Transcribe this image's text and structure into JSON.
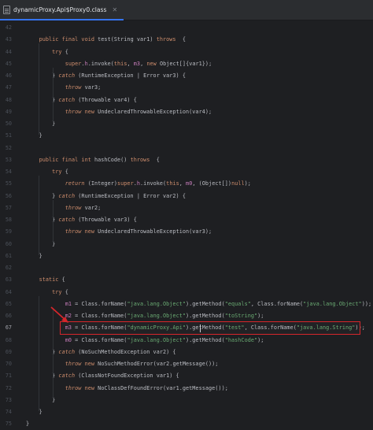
{
  "tab": {
    "label": "dynamicProxy.Api$Proxy0.class",
    "icon": "class-file-icon"
  },
  "editor": {
    "current_line": "67",
    "lines": [
      {
        "n": "42",
        "segs": []
      },
      {
        "n": "43",
        "segs": [
          [
            "    ",
            ""
          ],
          [
            "public final void",
            "kw"
          ],
          [
            " test(String var1) ",
            ""
          ],
          [
            "throws",
            "kw"
          ],
          [
            "  {",
            ""
          ]
        ]
      },
      {
        "n": "44",
        "segs": [
          [
            "        ",
            ""
          ],
          [
            "try",
            "kw"
          ],
          [
            " {",
            ""
          ]
        ]
      },
      {
        "n": "45",
        "segs": [
          [
            "            ",
            ""
          ],
          [
            "super",
            "kw"
          ],
          [
            ".",
            ""
          ],
          [
            "h",
            "fld"
          ],
          [
            ".invoke(",
            ""
          ],
          [
            "this",
            "kw"
          ],
          [
            ", ",
            ""
          ],
          [
            "m3",
            "fld"
          ],
          [
            ", ",
            ""
          ],
          [
            "new",
            "kw"
          ],
          [
            " Object[]{var1});",
            ""
          ]
        ]
      },
      {
        "n": "46",
        "segs": [
          [
            "        } ",
            ""
          ],
          [
            "catch",
            "kwi"
          ],
          [
            " (RuntimeException | Error var3) {",
            ""
          ]
        ]
      },
      {
        "n": "47",
        "segs": [
          [
            "            ",
            ""
          ],
          [
            "throw",
            "kwi"
          ],
          [
            " var3;",
            ""
          ]
        ]
      },
      {
        "n": "48",
        "segs": [
          [
            "        } ",
            ""
          ],
          [
            "catch",
            "kwi"
          ],
          [
            " (Throwable var4) {",
            ""
          ]
        ]
      },
      {
        "n": "49",
        "segs": [
          [
            "            ",
            ""
          ],
          [
            "throw",
            "kwi"
          ],
          [
            " ",
            ""
          ],
          [
            "new",
            "kw"
          ],
          [
            " UndeclaredThrowableException(var4);",
            ""
          ]
        ]
      },
      {
        "n": "50",
        "segs": [
          [
            "        }",
            ""
          ]
        ]
      },
      {
        "n": "51",
        "segs": [
          [
            "    }",
            ""
          ]
        ]
      },
      {
        "n": "52",
        "segs": []
      },
      {
        "n": "53",
        "segs": [
          [
            "    ",
            ""
          ],
          [
            "public final int",
            "kw"
          ],
          [
            " hashCode() ",
            ""
          ],
          [
            "throws",
            "kw"
          ],
          [
            "  {",
            ""
          ]
        ]
      },
      {
        "n": "54",
        "segs": [
          [
            "        ",
            ""
          ],
          [
            "try",
            "kw"
          ],
          [
            " {",
            ""
          ]
        ]
      },
      {
        "n": "55",
        "segs": [
          [
            "            ",
            ""
          ],
          [
            "return",
            "kwi"
          ],
          [
            " (Integer)",
            ""
          ],
          [
            "super",
            "kw"
          ],
          [
            ".",
            ""
          ],
          [
            "h",
            "fld"
          ],
          [
            ".invoke(",
            ""
          ],
          [
            "this",
            "kw"
          ],
          [
            ", ",
            ""
          ],
          [
            "m0",
            "fld"
          ],
          [
            ", (Object[])",
            ""
          ],
          [
            "null",
            "kw"
          ],
          [
            ");",
            ""
          ]
        ]
      },
      {
        "n": "56",
        "segs": [
          [
            "        } ",
            ""
          ],
          [
            "catch",
            "kwi"
          ],
          [
            " (RuntimeException | Error var2) {",
            ""
          ]
        ]
      },
      {
        "n": "57",
        "segs": [
          [
            "            ",
            ""
          ],
          [
            "throw",
            "kwi"
          ],
          [
            " var2;",
            ""
          ]
        ]
      },
      {
        "n": "58",
        "segs": [
          [
            "        } ",
            ""
          ],
          [
            "catch",
            "kwi"
          ],
          [
            " (Throwable var3) {",
            ""
          ]
        ]
      },
      {
        "n": "59",
        "segs": [
          [
            "            ",
            ""
          ],
          [
            "throw",
            "kwi"
          ],
          [
            " ",
            ""
          ],
          [
            "new",
            "kw"
          ],
          [
            " UndeclaredThrowableException(var3);",
            ""
          ]
        ]
      },
      {
        "n": "60",
        "segs": [
          [
            "        }",
            ""
          ]
        ]
      },
      {
        "n": "61",
        "segs": [
          [
            "    }",
            ""
          ]
        ]
      },
      {
        "n": "62",
        "segs": []
      },
      {
        "n": "63",
        "segs": [
          [
            "    ",
            ""
          ],
          [
            "static",
            "kw"
          ],
          [
            " {",
            ""
          ]
        ]
      },
      {
        "n": "64",
        "segs": [
          [
            "        ",
            ""
          ],
          [
            "try",
            "kw"
          ],
          [
            " {",
            ""
          ]
        ]
      },
      {
        "n": "65",
        "segs": [
          [
            "            ",
            ""
          ],
          [
            "m1",
            "fld"
          ],
          [
            " = Class.forName(",
            ""
          ],
          [
            "\"java.lang.Object\"",
            "str"
          ],
          [
            ").getMethod(",
            ""
          ],
          [
            "\"equals\"",
            "str"
          ],
          [
            ", Class.forName(",
            ""
          ],
          [
            "\"java.lang.Object\"",
            "str"
          ],
          [
            "));",
            ""
          ]
        ]
      },
      {
        "n": "66",
        "segs": [
          [
            "            ",
            ""
          ],
          [
            "m2",
            "fld"
          ],
          [
            " = Class.forName(",
            ""
          ],
          [
            "\"java.lang.Object\"",
            "str"
          ],
          [
            ").getMethod(",
            ""
          ],
          [
            "\"toString\"",
            "str"
          ],
          [
            ");",
            ""
          ]
        ]
      },
      {
        "n": "67",
        "segs": [
          [
            "            ",
            ""
          ],
          [
            "m3",
            "fld"
          ],
          [
            " = Class.forName(",
            ""
          ],
          [
            "\"dynamicProxy.Api\"",
            "str"
          ],
          [
            ").getMethod(",
            ""
          ],
          [
            "\"test\"",
            "str"
          ],
          [
            ", Class.forName(",
            ""
          ],
          [
            "\"java.lang.String\"",
            "str"
          ],
          [
            "));",
            ""
          ]
        ]
      },
      {
        "n": "68",
        "segs": [
          [
            "            ",
            ""
          ],
          [
            "m0",
            "fld"
          ],
          [
            " = Class.forName(",
            ""
          ],
          [
            "\"java.lang.Object\"",
            "str"
          ],
          [
            ").getMethod(",
            ""
          ],
          [
            "\"hashCode\"",
            "str"
          ],
          [
            ");",
            ""
          ]
        ]
      },
      {
        "n": "69",
        "segs": [
          [
            "        } ",
            ""
          ],
          [
            "catch",
            "kwi"
          ],
          [
            " (NoSuchMethodException var2) {",
            ""
          ]
        ]
      },
      {
        "n": "70",
        "segs": [
          [
            "            ",
            ""
          ],
          [
            "throw",
            "kwi"
          ],
          [
            " ",
            ""
          ],
          [
            "new",
            "kw"
          ],
          [
            " NoSuchMethodError(var2.getMessage());",
            ""
          ]
        ]
      },
      {
        "n": "71",
        "segs": [
          [
            "        } ",
            ""
          ],
          [
            "catch",
            "kwi"
          ],
          [
            " (ClassNotFoundException var1) {",
            ""
          ]
        ]
      },
      {
        "n": "72",
        "segs": [
          [
            "            ",
            ""
          ],
          [
            "throw",
            "kwi"
          ],
          [
            " ",
            ""
          ],
          [
            "new",
            "kw"
          ],
          [
            " NoClassDefFoundError(var1.getMessage());",
            ""
          ]
        ]
      },
      {
        "n": "73",
        "segs": [
          [
            "        }",
            ""
          ]
        ]
      },
      {
        "n": "74",
        "segs": [
          [
            "    }",
            ""
          ]
        ]
      },
      {
        "n": "75",
        "segs": [
          [
            "}",
            ""
          ]
        ]
      }
    ]
  },
  "annotation": {
    "highlighted_line": "67",
    "box_color": "#d6262b",
    "arrow_color": "#d6262b"
  }
}
